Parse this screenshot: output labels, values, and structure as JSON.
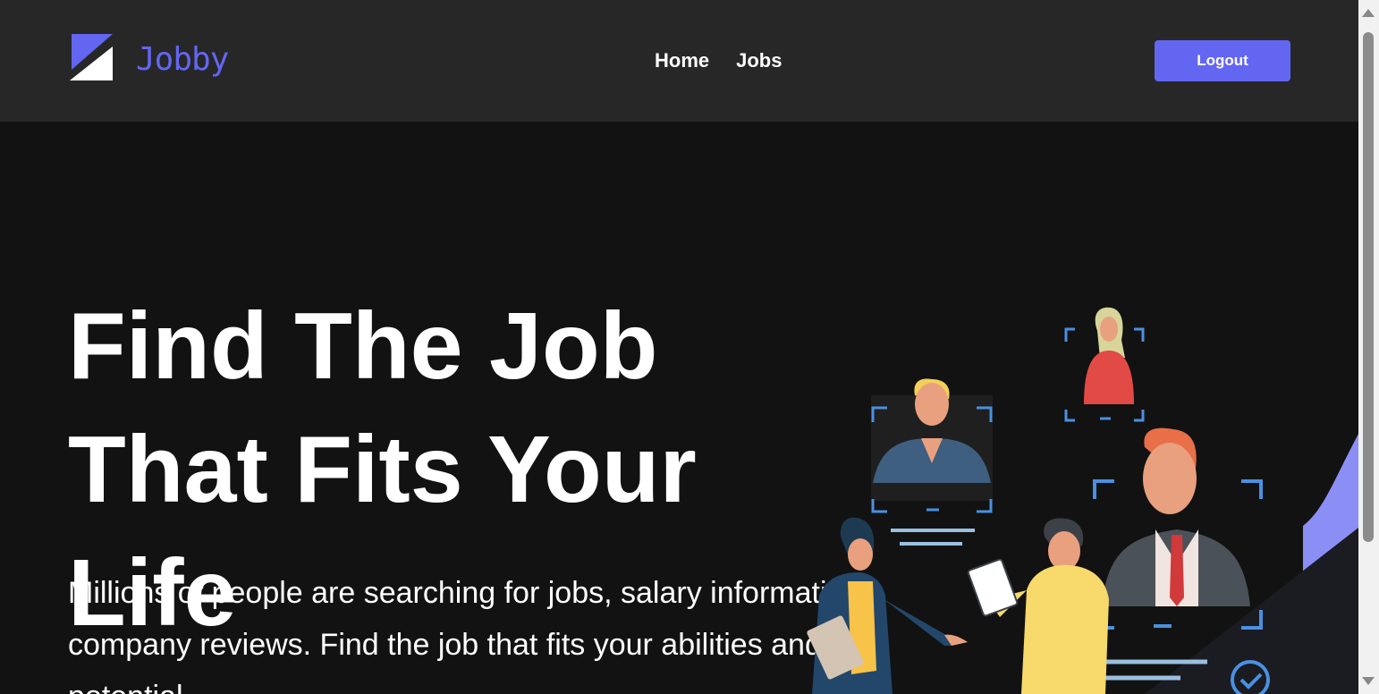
{
  "navbar": {
    "logo_text": "Jobby",
    "links": [
      {
        "label": "Home"
      },
      {
        "label": "Jobs"
      }
    ],
    "logout_label": "Logout"
  },
  "hero": {
    "title": "Find The Job That Fits Your Life",
    "description": "Millions of people are searching for jobs, salary information, company reviews. Find the job that fits your abilities and potential."
  },
  "colors": {
    "accent": "#6366f1",
    "navbar_bg": "#272727",
    "page_bg": "#121212"
  },
  "icons": {
    "logo": "jobby-logo-icon",
    "illustration": "hiring-illustration"
  }
}
